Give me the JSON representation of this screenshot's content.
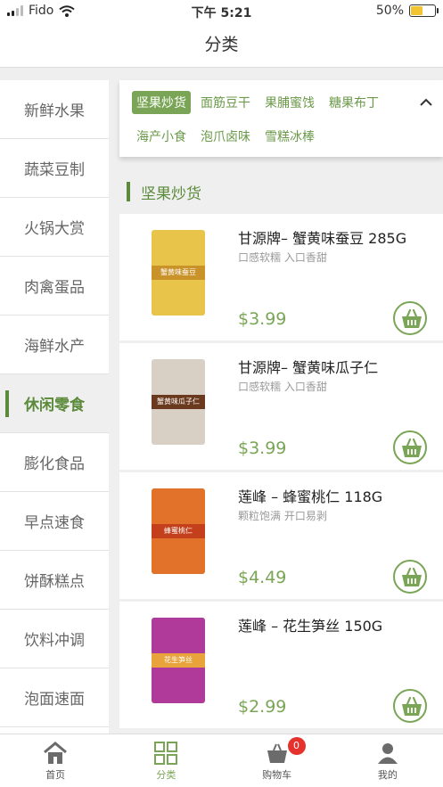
{
  "status_bar": {
    "carrier": "Fido",
    "time": "下午 5:21",
    "battery": "50%",
    "battery_level": 0.5
  },
  "header": {
    "title": "分类"
  },
  "sidebar": {
    "items": [
      {
        "label": "新鲜水果"
      },
      {
        "label": "蔬菜豆制"
      },
      {
        "label": "火锅大赏"
      },
      {
        "label": "肉禽蛋品"
      },
      {
        "label": "海鲜水产"
      },
      {
        "label": "休闲零食",
        "active": true
      },
      {
        "label": "膨化食品"
      },
      {
        "label": "早点速食"
      },
      {
        "label": "饼酥糕点"
      },
      {
        "label": "饮料冲调"
      },
      {
        "label": "泡面速面"
      }
    ]
  },
  "subcategories": {
    "tags": [
      {
        "label": "坚果炒货",
        "active": true
      },
      {
        "label": "面筋豆干"
      },
      {
        "label": "果脯蜜饯"
      },
      {
        "label": "糖果布丁"
      },
      {
        "label": "海产小食"
      },
      {
        "label": "泡爪卤味"
      },
      {
        "label": "雪糕冰棒"
      }
    ],
    "collapse_icon": "chevron-up-icon"
  },
  "section": {
    "title": "坚果炒货"
  },
  "products": [
    {
      "name": "甘源牌– 蟹黄味蚕豆 285G",
      "desc": "口感软糯 入口香甜",
      "price": "$3.99",
      "package_text": "蟹黄味蚕豆",
      "package_color": "#e8c44a",
      "band_color": "#c9932a"
    },
    {
      "name": "甘源牌– 蟹黄味瓜子仁",
      "desc": "口感软糯 入口香甜",
      "price": "$3.99",
      "package_text": "蟹黄味瓜子仁",
      "package_color": "#d8d0c4",
      "band_color": "#6b3a1e"
    },
    {
      "name": "莲峰 – 蜂蜜桃仁 118G",
      "desc": "颗粒饱满 开口易剥",
      "price": "$4.49",
      "package_text": "蜂蜜桃仁",
      "package_color": "#e2722a",
      "band_color": "#c4401c"
    },
    {
      "name": "莲峰 – 花生笋丝 150G",
      "desc": "",
      "price": "$2.99",
      "package_text": "花生笋丝",
      "package_color": "#b03a9a",
      "band_color": "#e8a33a"
    }
  ],
  "tab_bar": {
    "items": [
      {
        "label": "首页",
        "icon": "home-icon"
      },
      {
        "label": "分类",
        "icon": "category-grid-icon",
        "active": true
      },
      {
        "label": "购物车",
        "icon": "cart-icon",
        "badge": "0"
      },
      {
        "label": "我的",
        "icon": "user-icon"
      }
    ]
  },
  "colors": {
    "accent": "#7aa556",
    "accent_dark": "#5a8a3a",
    "badge": "#e5322d"
  }
}
